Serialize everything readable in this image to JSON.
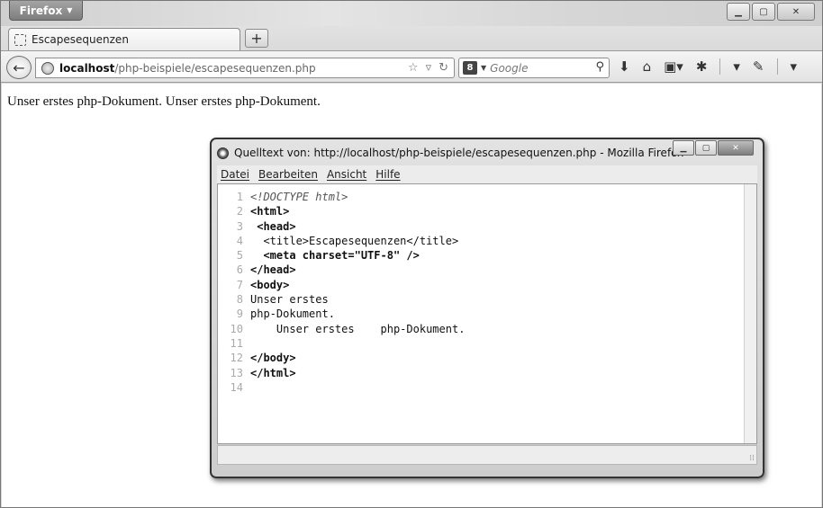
{
  "browser": {
    "menu_label": "Firefox",
    "tab_title": "Escapesequenzen",
    "new_tab": "+",
    "url_host": "localhost",
    "url_path": "/php-beispiele/escapesequenzen.php",
    "search_placeholder": "Google",
    "search_engine": "8"
  },
  "page": {
    "body_text": "Unser erstes php-Dokument. Unser erstes php-Dokument."
  },
  "source_window": {
    "title": "Quelltext von: http://localhost/php-beispiele/escapesequenzen.php - Mozilla Firefox",
    "menu": [
      "Datei",
      "Bearbeiten",
      "Ansicht",
      "Hilfe"
    ],
    "lines": [
      {
        "n": "1",
        "code": "<!DOCTYPE html>",
        "style": "i"
      },
      {
        "n": "2",
        "code": "<html>",
        "style": "b"
      },
      {
        "n": "3",
        "code": " <head>",
        "style": "b"
      },
      {
        "n": "4",
        "code": "  <title>Escapesequenzen</title>",
        "style": "t"
      },
      {
        "n": "5",
        "code": "  <meta charset=\"UTF-8\" />",
        "style": "b"
      },
      {
        "n": "6",
        "code": "</head>",
        "style": "b"
      },
      {
        "n": "7",
        "code": "<body>",
        "style": "b"
      },
      {
        "n": "8",
        "code": "Unser erstes",
        "style": "t"
      },
      {
        "n": "9",
        "code": "php-Dokument.",
        "style": "t"
      },
      {
        "n": "10",
        "code": "    Unser erstes    php-Dokument.",
        "style": "t"
      },
      {
        "n": "11",
        "code": "",
        "style": "t"
      },
      {
        "n": "12",
        "code": "</body>",
        "style": "b"
      },
      {
        "n": "13",
        "code": "</html>",
        "style": "b"
      },
      {
        "n": "14",
        "code": "",
        "style": "t"
      }
    ]
  }
}
